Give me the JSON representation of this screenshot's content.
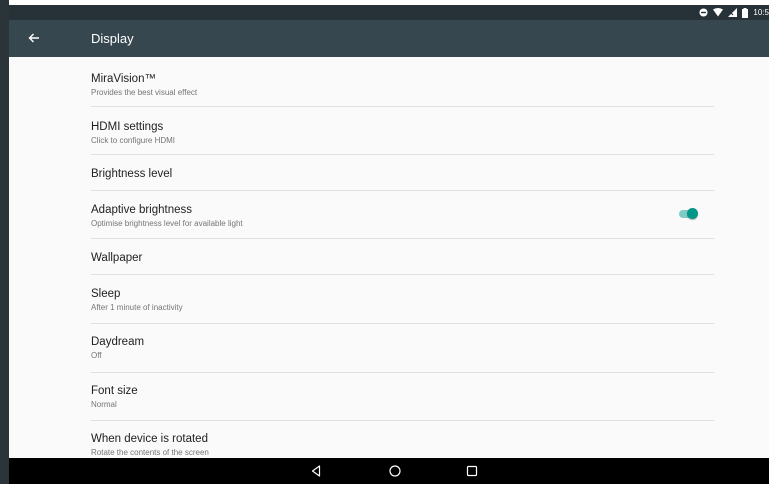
{
  "status_bar": {
    "time": "10:5"
  },
  "app_bar": {
    "title": "Display"
  },
  "settings": [
    {
      "title": "MiraVision™",
      "summary": "Provides the best visual effect"
    },
    {
      "title": "HDMI settings",
      "summary": "Click to configure HDMI"
    },
    {
      "title": "Brightness level"
    },
    {
      "title": "Adaptive brightness",
      "summary": "Optimise brightness level for available light",
      "toggle_on": true
    },
    {
      "title": "Wallpaper"
    },
    {
      "title": "Sleep",
      "summary": "After 1 minute of inactivity"
    },
    {
      "title": "Daydream",
      "summary": "Off"
    },
    {
      "title": "Font size",
      "summary": "Normal"
    },
    {
      "title": "When device is rotated",
      "summary": "Rotate the contents of the screen"
    }
  ],
  "colors": {
    "app_bar": "#37474f",
    "status_bar": "#263238",
    "accent": "#009688"
  },
  "icons": {
    "back": "arrow-back-icon",
    "nav": [
      "nav-back-icon",
      "nav-home-icon",
      "nav-recents-icon"
    ]
  }
}
